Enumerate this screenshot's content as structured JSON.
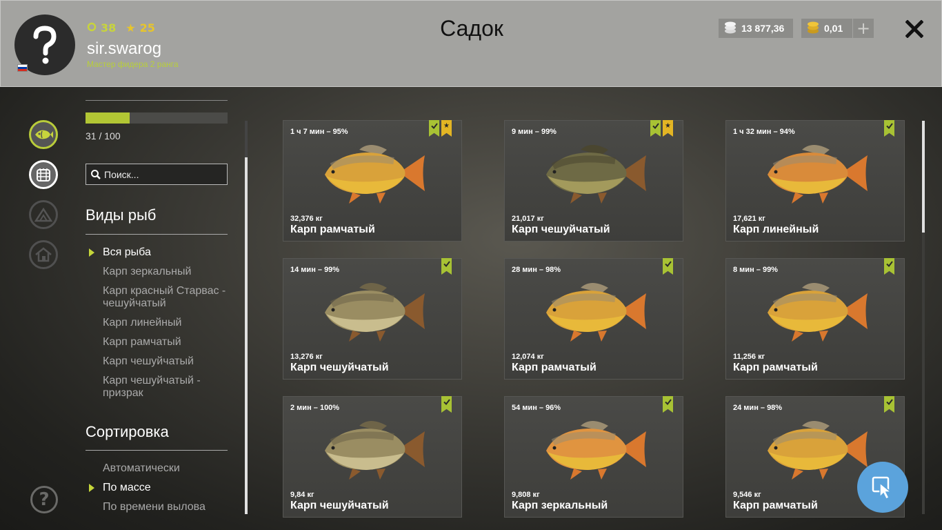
{
  "header": {
    "title": "Садок",
    "player": {
      "username": "sir.swarog",
      "rank": "Мастер фидера 2 ранга",
      "level": "38",
      "stars": "25",
      "avatar_icon": "question-mark-icon",
      "flag_colors": [
        "#ffffff",
        "#0039a6",
        "#d52b1e"
      ]
    },
    "currency": {
      "silver": "13 877,36",
      "gold": "0,01",
      "add_label": "+"
    },
    "close_icon": "close-icon"
  },
  "sidebar": {
    "nav": [
      {
        "icon": "fish-icon",
        "active": true
      },
      {
        "icon": "keepnet-icon",
        "active": true
      },
      {
        "icon": "tent-icon",
        "active": false
      },
      {
        "icon": "home-icon",
        "active": false
      }
    ],
    "capacity": {
      "current": 31,
      "max": 100,
      "label": "31 / 100",
      "fraction": 0.31
    },
    "search": {
      "placeholder": "Поиск..."
    },
    "species_title": "Виды рыб",
    "species": [
      {
        "label": "Вся рыба",
        "active": true
      },
      {
        "label": "Карп зеркальный",
        "active": false
      },
      {
        "label": "Карп красный Старвас - чешуйчатый",
        "active": false
      },
      {
        "label": "Карп линейный",
        "active": false
      },
      {
        "label": "Карп рамчатый",
        "active": false
      },
      {
        "label": "Карп чешуйчатый",
        "active": false
      },
      {
        "label": "Карп чешуйчатый - призрак",
        "active": false
      }
    ],
    "sort_title": "Сортировка",
    "sort": [
      {
        "label": "Автоматически",
        "active": false
      },
      {
        "label": "По массе",
        "active": true
      },
      {
        "label": "По времени вылова",
        "active": false
      }
    ]
  },
  "fish_cards": [
    {
      "time": "1 ч 7 мин – 95%",
      "weight": "32,376 кг",
      "name": "Карп рамчатый",
      "badges": [
        "check",
        "star"
      ],
      "variant": "mirror",
      "tint": "#d9a23a"
    },
    {
      "time": "9 мин – 99%",
      "weight": "21,017 кг",
      "name": "Карп чешуйчатый",
      "badges": [
        "check",
        "star"
      ],
      "variant": "scaled-dark",
      "tint": "#6e6a45"
    },
    {
      "time": "1 ч 32 мин – 94%",
      "weight": "17,621 кг",
      "name": "Карп линейный",
      "badges": [
        "check"
      ],
      "variant": "mirror",
      "tint": "#d98b3a"
    },
    {
      "time": "14 мин – 99%",
      "weight": "13,276 кг",
      "name": "Карп чешуйчатый",
      "badges": [
        "check"
      ],
      "variant": "scaled",
      "tint": "#9a8d62"
    },
    {
      "time": "28 мин – 98%",
      "weight": "12,074 кг",
      "name": "Карп рамчатый",
      "badges": [
        "check"
      ],
      "variant": "mirror",
      "tint": "#d9a23a"
    },
    {
      "time": "8 мин – 99%",
      "weight": "11,256 кг",
      "name": "Карп рамчатый",
      "badges": [
        "check"
      ],
      "variant": "mirror",
      "tint": "#d9a23a"
    },
    {
      "time": "2 мин – 100%",
      "weight": "9,84 кг",
      "name": "Карп чешуйчатый",
      "badges": [
        "check"
      ],
      "variant": "scaled",
      "tint": "#9a8d62"
    },
    {
      "time": "54 мин – 96%",
      "weight": "9,808 кг",
      "name": "Карп зеркальный",
      "badges": [
        "check"
      ],
      "variant": "mirror",
      "tint": "#e09440"
    },
    {
      "time": "24 мин – 98%",
      "weight": "9,546 кг",
      "name": "Карп рамчатый",
      "badges": [
        "check"
      ],
      "variant": "mirror",
      "tint": "#d9a23a"
    }
  ],
  "cursor_button": {
    "icon": "cursor-icon"
  }
}
